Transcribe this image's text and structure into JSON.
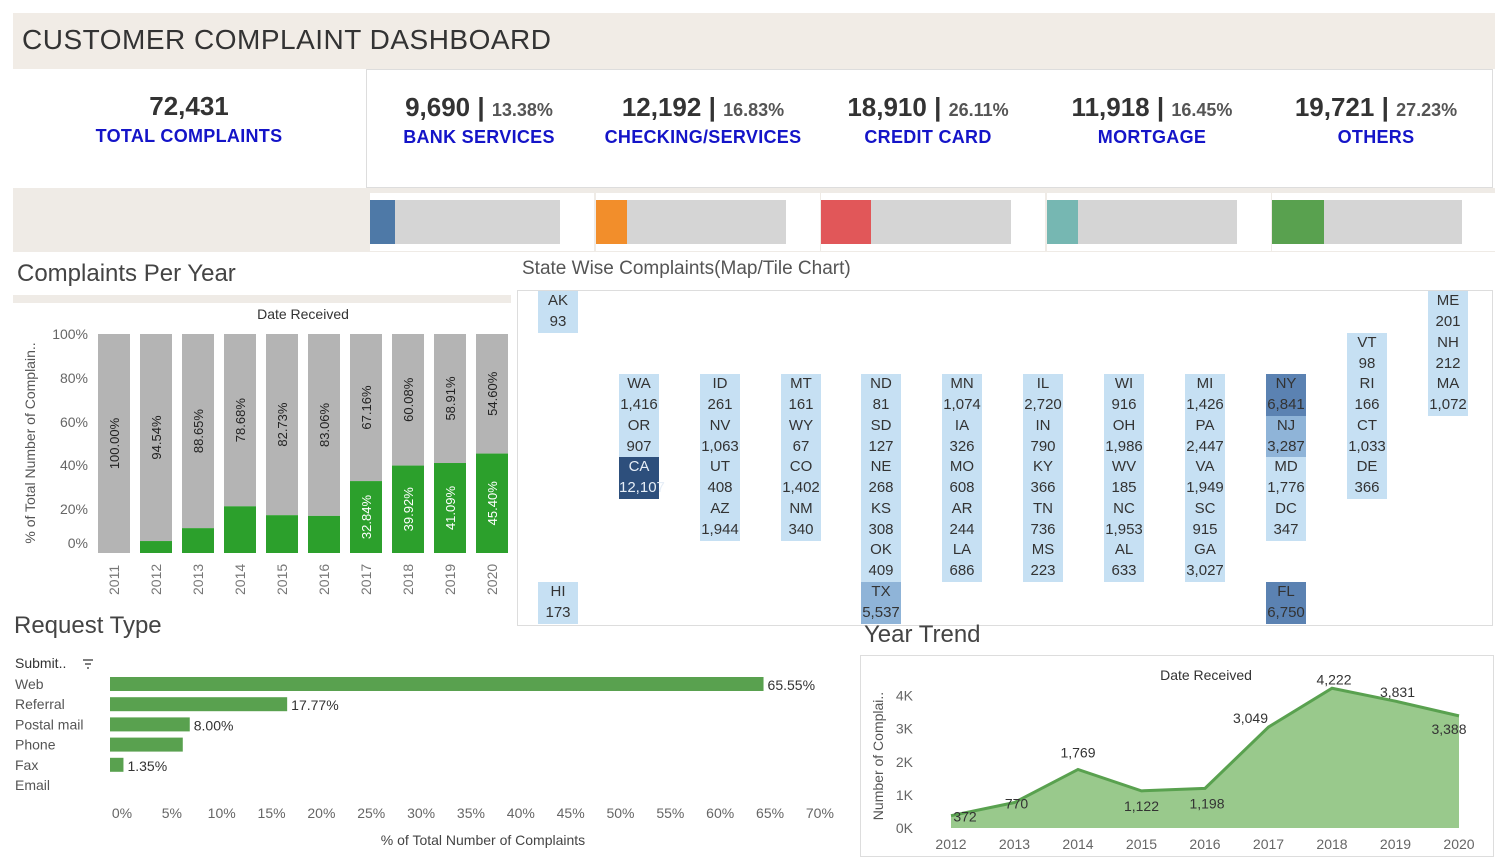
{
  "header": {
    "title": "CUSTOMER COMPLAINT DASHBOARD"
  },
  "kpis": {
    "total": {
      "value": "72,431",
      "label": "TOTAL COMPLAINTS"
    },
    "items": [
      {
        "value": "9,690",
        "pct": "13.38%",
        "label": "BANK SERVICES",
        "color": "#4e79a7",
        "share": 0.1338
      },
      {
        "value": "12,192",
        "pct": "16.83%",
        "label": "CHECKING/SERVICES",
        "color": "#f28e2b",
        "share": 0.1683
      },
      {
        "value": "18,910",
        "pct": "26.11%",
        "label": "CREDIT CARD",
        "color": "#e15759",
        "share": 0.2611
      },
      {
        "value": "11,918",
        "pct": "16.45%",
        "label": "MORTGAGE",
        "color": "#76b7b2",
        "share": 0.1645
      },
      {
        "value": "19,721",
        "pct": "27.23%",
        "label": "OTHERS",
        "color": "#59a14f",
        "share": 0.2723
      }
    ]
  },
  "sections": {
    "per_year": "Complaints Per Year",
    "state": "State Wise Complaints(Map/Tile Chart)",
    "request": "Request Type",
    "trend": "Year Trend"
  },
  "per_year_chart": {
    "header": "Date Received",
    "ylabel": "% of Total Number of Complain..",
    "yticks": [
      "100%",
      "80%",
      "60%",
      "40%",
      "20%",
      "0%"
    ]
  },
  "request_chart": {
    "header": "Submit..",
    "xlabel": "% of Total Number of Complaints",
    "xticks": [
      "0%",
      "5%",
      "10%",
      "15%",
      "20%",
      "25%",
      "30%",
      "35%",
      "40%",
      "45%",
      "50%",
      "55%",
      "60%",
      "65%",
      "70%"
    ]
  },
  "trend_chart": {
    "header": "Date Received",
    "ylabel": "Number of Complai..",
    "yticks": [
      "4K",
      "3K",
      "2K",
      "1K",
      "0K"
    ]
  },
  "states": [
    {
      "code": "AK",
      "value": "93",
      "col": 0,
      "row": 0,
      "tone": 1
    },
    {
      "code": "ME",
      "value": "201",
      "col": 11,
      "row": 0,
      "tone": 1
    },
    {
      "code": "VT",
      "value": "98",
      "col": 10,
      "row": 1,
      "tone": 1
    },
    {
      "code": "NH",
      "value": "212",
      "col": 11,
      "row": 1,
      "tone": 1
    },
    {
      "code": "WA",
      "value": "1,416",
      "col": 1,
      "row": 2,
      "tone": 1
    },
    {
      "code": "ID",
      "value": "261",
      "col": 2,
      "row": 2,
      "tone": 1
    },
    {
      "code": "MT",
      "value": "161",
      "col": 3,
      "row": 2,
      "tone": 1
    },
    {
      "code": "ND",
      "value": "81",
      "col": 4,
      "row": 2,
      "tone": 1
    },
    {
      "code": "MN",
      "value": "1,074",
      "col": 5,
      "row": 2,
      "tone": 1
    },
    {
      "code": "IL",
      "value": "2,720",
      "col": 6,
      "row": 2,
      "tone": 1
    },
    {
      "code": "WI",
      "value": "916",
      "col": 7,
      "row": 2,
      "tone": 1
    },
    {
      "code": "MI",
      "value": "1,426",
      "col": 8,
      "row": 2,
      "tone": 1
    },
    {
      "code": "NY",
      "value": "6,841",
      "col": 9,
      "row": 2,
      "tone": 3
    },
    {
      "code": "RI",
      "value": "166",
      "col": 10,
      "row": 2,
      "tone": 1
    },
    {
      "code": "MA",
      "value": "1,072",
      "col": 11,
      "row": 2,
      "tone": 1
    },
    {
      "code": "OR",
      "value": "907",
      "col": 1,
      "row": 3,
      "tone": 1
    },
    {
      "code": "NV",
      "value": "1,063",
      "col": 2,
      "row": 3,
      "tone": 1
    },
    {
      "code": "WY",
      "value": "67",
      "col": 3,
      "row": 3,
      "tone": 1
    },
    {
      "code": "SD",
      "value": "127",
      "col": 4,
      "row": 3,
      "tone": 1
    },
    {
      "code": "IA",
      "value": "326",
      "col": 5,
      "row": 3,
      "tone": 1
    },
    {
      "code": "IN",
      "value": "790",
      "col": 6,
      "row": 3,
      "tone": 1
    },
    {
      "code": "OH",
      "value": "1,986",
      "col": 7,
      "row": 3,
      "tone": 1
    },
    {
      "code": "PA",
      "value": "2,447",
      "col": 8,
      "row": 3,
      "tone": 1
    },
    {
      "code": "NJ",
      "value": "3,287",
      "col": 9,
      "row": 3,
      "tone": 2
    },
    {
      "code": "CT",
      "value": "1,033",
      "col": 10,
      "row": 3,
      "tone": 1
    },
    {
      "code": "CA",
      "value": "12,107",
      "col": 1,
      "row": 4,
      "tone": 4
    },
    {
      "code": "UT",
      "value": "408",
      "col": 2,
      "row": 4,
      "tone": 1
    },
    {
      "code": "CO",
      "value": "1,402",
      "col": 3,
      "row": 4,
      "tone": 1
    },
    {
      "code": "NE",
      "value": "268",
      "col": 4,
      "row": 4,
      "tone": 1
    },
    {
      "code": "MO",
      "value": "608",
      "col": 5,
      "row": 4,
      "tone": 1
    },
    {
      "code": "KY",
      "value": "366",
      "col": 6,
      "row": 4,
      "tone": 1
    },
    {
      "code": "WV",
      "value": "185",
      "col": 7,
      "row": 4,
      "tone": 1
    },
    {
      "code": "VA",
      "value": "1,949",
      "col": 8,
      "row": 4,
      "tone": 1
    },
    {
      "code": "MD",
      "value": "1,776",
      "col": 9,
      "row": 4,
      "tone": 1
    },
    {
      "code": "DE",
      "value": "366",
      "col": 10,
      "row": 4,
      "tone": 1
    },
    {
      "code": "AZ",
      "value": "1,944",
      "col": 2,
      "row": 5,
      "tone": 1
    },
    {
      "code": "NM",
      "value": "340",
      "col": 3,
      "row": 5,
      "tone": 1
    },
    {
      "code": "KS",
      "value": "308",
      "col": 4,
      "row": 5,
      "tone": 1
    },
    {
      "code": "AR",
      "value": "244",
      "col": 5,
      "row": 5,
      "tone": 1
    },
    {
      "code": "TN",
      "value": "736",
      "col": 6,
      "row": 5,
      "tone": 1
    },
    {
      "code": "NC",
      "value": "1,953",
      "col": 7,
      "row": 5,
      "tone": 1
    },
    {
      "code": "SC",
      "value": "915",
      "col": 8,
      "row": 5,
      "tone": 1
    },
    {
      "code": "DC",
      "value": "347",
      "col": 9,
      "row": 5,
      "tone": 1
    },
    {
      "code": "OK",
      "value": "409",
      "col": 4,
      "row": 6,
      "tone": 1
    },
    {
      "code": "LA",
      "value": "686",
      "col": 5,
      "row": 6,
      "tone": 1
    },
    {
      "code": "MS",
      "value": "223",
      "col": 6,
      "row": 6,
      "tone": 1
    },
    {
      "code": "AL",
      "value": "633",
      "col": 7,
      "row": 6,
      "tone": 1
    },
    {
      "code": "GA",
      "value": "3,027",
      "col": 8,
      "row": 6,
      "tone": 1
    },
    {
      "code": "HI",
      "value": "173",
      "col": 0,
      "row": 7,
      "tone": 1
    },
    {
      "code": "TX",
      "value": "5,537",
      "col": 4,
      "row": 7,
      "tone": 2
    },
    {
      "code": "FL",
      "value": "6,750",
      "col": 9,
      "row": 7,
      "tone": 3
    }
  ],
  "chart_data": [
    {
      "type": "bar",
      "title": "Complaints Per Year",
      "xlabel": "Date Received",
      "ylabel": "% of Total Number of Complain..",
      "categories": [
        "2011",
        "2012",
        "2013",
        "2014",
        "2015",
        "2016",
        "2017",
        "2018",
        "2019",
        "2020"
      ],
      "series": [
        {
          "values": [
            0,
            5.46,
            11.35,
            21.32,
            17.27,
            16.94,
            32.84,
            39.92,
            41.09,
            45.4
          ],
          "labels": [
            "",
            "",
            "",
            "",
            "",
            "",
            "32.84%",
            "39.92%",
            "41.09%",
            "45.40%"
          ],
          "color": "#2ca02c"
        },
        {
          "values": [
            100,
            94.54,
            88.65,
            78.68,
            82.73,
            83.06,
            67.16,
            60.08,
            58.91,
            54.6
          ],
          "labels": [
            "100.00%",
            "94.54%",
            "88.65%",
            "78.68%",
            "82.73%",
            "83.06%",
            "67.16%",
            "60.08%",
            "58.91%",
            "54.60%"
          ],
          "color": "#b4b4b4"
        }
      ],
      "ylim": [
        0,
        100
      ]
    },
    {
      "type": "bar",
      "orientation": "horizontal",
      "title": "Request Type",
      "xlabel": "% of Total Number of Complaints",
      "categories": [
        "Web",
        "Referral",
        "Postal mail",
        "Phone",
        "Fax",
        "Email"
      ],
      "values": [
        65.55,
        17.77,
        8.0,
        7.3,
        1.35,
        0
      ],
      "labels": [
        "65.55%",
        "17.77%",
        "8.00%",
        "",
        "1.35%",
        ""
      ],
      "xlim": [
        0,
        70
      ],
      "color": "#59a14f"
    },
    {
      "type": "area",
      "title": "Year Trend",
      "xlabel": "Date Received",
      "ylabel": "Number of Complai..",
      "x": [
        "2012",
        "2013",
        "2014",
        "2015",
        "2016",
        "2017",
        "2018",
        "2019",
        "2020"
      ],
      "values": [
        372,
        770,
        1769,
        1122,
        1198,
        3049,
        4222,
        3831,
        3388
      ],
      "labels": [
        "372",
        "770",
        "1,769",
        "1,122",
        "1,198",
        "3,049",
        "4,222",
        "3,831",
        "3,388"
      ],
      "ylim": [
        0,
        4500
      ],
      "color": "#59a14f"
    }
  ]
}
